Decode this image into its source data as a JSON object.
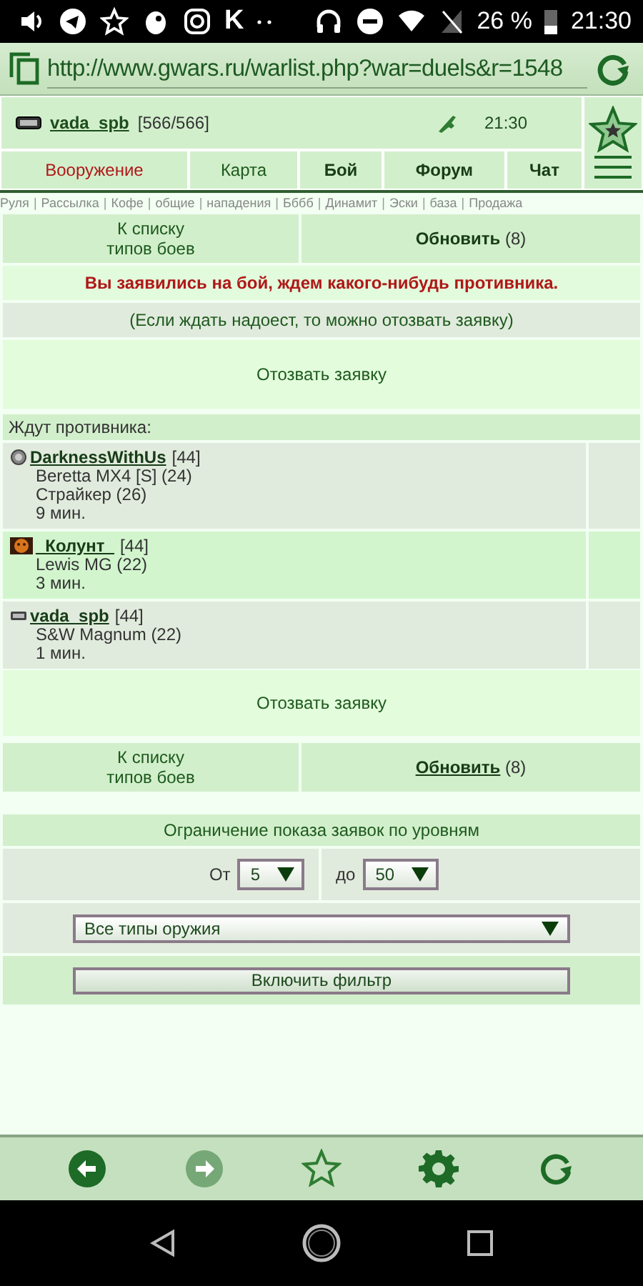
{
  "status_bar": {
    "app_letter": "K",
    "battery": "26 %",
    "time": "21:30"
  },
  "address_bar": {
    "url": "http://www.gwars.ru/warlist.php?war=duels&r=1548"
  },
  "header": {
    "user": "vada_spb",
    "hp": "[566/566]",
    "time": "21:30",
    "nav": [
      {
        "label": "Вооружение",
        "kind": "alert"
      },
      {
        "label": "Карта",
        "kind": "plain"
      },
      {
        "label": "Бой",
        "kind": "bold"
      },
      {
        "label": "Форум",
        "kind": "bold"
      },
      {
        "label": "Чат",
        "kind": "bold"
      }
    ]
  },
  "quick_links": {
    "separator": "|",
    "items": [
      "Руля",
      "Рассылка",
      "Кофе",
      "общие",
      "нападения",
      "Бббб",
      "Динамит",
      "Эски",
      "база",
      "Продажа"
    ]
  },
  "top_actions": {
    "list_link": "К списку\nтипов боев",
    "refresh": "**Обновить** (8)",
    "refresh_underlined": false
  },
  "message": "Вы заявились на бой, ждем какого-нибудь противника.",
  "hint": "(Если ждать надоест, то можно отозвать заявку)",
  "withdraw_top": "Отозвать заявку",
  "waiting": {
    "title": "Ждут противника:",
    "players": [
      {
        "name": "DarknessWithUs",
        "level": "[44]",
        "kind": "round",
        "weapons": [
          "Beretta MX4 [S] (24)",
          "Страйкер (26)"
        ],
        "time": "9 мин."
      },
      {
        "name": "_Колунт_",
        "level": "[44]",
        "kind": "face",
        "weapons": [
          "Lewis MG (22)"
        ],
        "time": "3 мин."
      },
      {
        "name": "vada_spb",
        "level": "[44]",
        "kind": "plate",
        "weapons": [
          "S&W Magnum (22)"
        ],
        "time": "1 мин."
      }
    ]
  },
  "withdraw_bottom": "Отозвать заявку",
  "bottom_actions": {
    "list_link": "К списку\nтипов боев",
    "refresh": "**Обновить** (8)",
    "refresh_underlined": true
  },
  "filter": {
    "title": "Ограничение показа заявок по уровням",
    "from_label": "От",
    "from_value": "5",
    "to_label": "до",
    "to_value": "50",
    "weapon_type": "Все типы оружия",
    "apply": "Включить фильтр"
  }
}
